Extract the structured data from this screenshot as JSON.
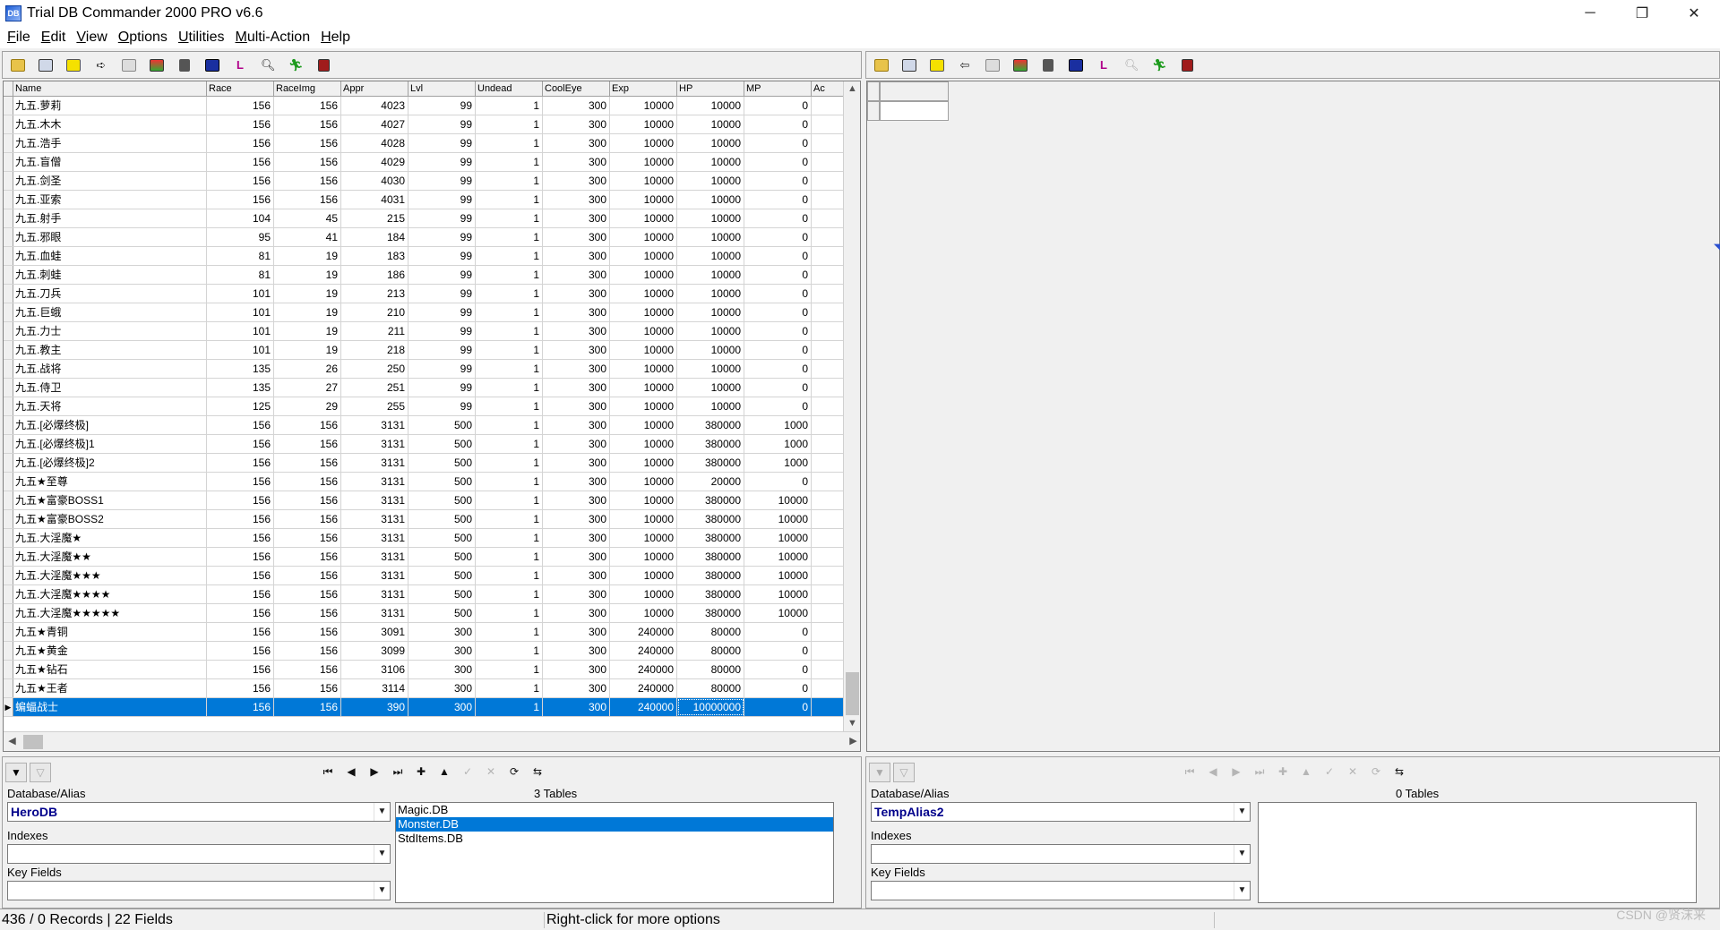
{
  "window": {
    "title": "Trial DB Commander 2000 PRO v6.6",
    "app_icon": "db-commander-app-icon",
    "controls": [
      "─",
      "❐",
      "✕"
    ]
  },
  "menu": [
    "File",
    "Edit",
    "View",
    "Options",
    "Utilities",
    "Multi-Action",
    "Help"
  ],
  "toolbar_icons_left": [
    "open-folder-icon",
    "table-icon",
    "key-icon",
    "arrow-icon",
    "page-icon",
    "filter-icon",
    "trash-icon",
    "db-icon",
    "l-icon",
    "search-icon",
    "run-icon",
    "exit-icon"
  ],
  "toolbar_icons_right": [
    "open-folder-icon",
    "table-icon",
    "key-icon",
    "arrow-icon",
    "page-icon",
    "filter-icon",
    "trash-icon",
    "db-icon",
    "l-icon",
    "search-icon",
    "run-icon",
    "exit-icon"
  ],
  "grid": {
    "columns": [
      "Name",
      "Race",
      "RaceImg",
      "Appr",
      "Lvl",
      "Undead",
      "CoolEye",
      "Exp",
      "HP",
      "MP",
      "Ac"
    ],
    "rows": [
      [
        "九五.萝莉",
        "156",
        "156",
        "4023",
        "99",
        "1",
        "300",
        "10000",
        "10000",
        "0",
        ""
      ],
      [
        "九五.木木",
        "156",
        "156",
        "4027",
        "99",
        "1",
        "300",
        "10000",
        "10000",
        "0",
        ""
      ],
      [
        "九五.浩手",
        "156",
        "156",
        "4028",
        "99",
        "1",
        "300",
        "10000",
        "10000",
        "0",
        ""
      ],
      [
        "九五.盲僧",
        "156",
        "156",
        "4029",
        "99",
        "1",
        "300",
        "10000",
        "10000",
        "0",
        ""
      ],
      [
        "九五.剑圣",
        "156",
        "156",
        "4030",
        "99",
        "1",
        "300",
        "10000",
        "10000",
        "0",
        ""
      ],
      [
        "九五.亚索",
        "156",
        "156",
        "4031",
        "99",
        "1",
        "300",
        "10000",
        "10000",
        "0",
        ""
      ],
      [
        "九五.射手",
        "104",
        "45",
        "215",
        "99",
        "1",
        "300",
        "10000",
        "10000",
        "0",
        ""
      ],
      [
        "九五.邪眼",
        "95",
        "41",
        "184",
        "99",
        "1",
        "300",
        "10000",
        "10000",
        "0",
        ""
      ],
      [
        "九五.血蛙",
        "81",
        "19",
        "183",
        "99",
        "1",
        "300",
        "10000",
        "10000",
        "0",
        ""
      ],
      [
        "九五.刺蛙",
        "81",
        "19",
        "186",
        "99",
        "1",
        "300",
        "10000",
        "10000",
        "0",
        ""
      ],
      [
        "九五.刀兵",
        "101",
        "19",
        "213",
        "99",
        "1",
        "300",
        "10000",
        "10000",
        "0",
        ""
      ],
      [
        "九五.巨蛾",
        "101",
        "19",
        "210",
        "99",
        "1",
        "300",
        "10000",
        "10000",
        "0",
        ""
      ],
      [
        "九五.力士",
        "101",
        "19",
        "211",
        "99",
        "1",
        "300",
        "10000",
        "10000",
        "0",
        ""
      ],
      [
        "九五.教主",
        "101",
        "19",
        "218",
        "99",
        "1",
        "300",
        "10000",
        "10000",
        "0",
        ""
      ],
      [
        "九五.战将",
        "135",
        "26",
        "250",
        "99",
        "1",
        "300",
        "10000",
        "10000",
        "0",
        ""
      ],
      [
        "九五.侍卫",
        "135",
        "27",
        "251",
        "99",
        "1",
        "300",
        "10000",
        "10000",
        "0",
        ""
      ],
      [
        "九五.天将",
        "125",
        "29",
        "255",
        "99",
        "1",
        "300",
        "10000",
        "10000",
        "0",
        ""
      ],
      [
        "九五.[必爆终极]",
        "156",
        "156",
        "3131",
        "500",
        "1",
        "300",
        "10000",
        "380000",
        "1000",
        ""
      ],
      [
        "九五.[必爆终极]1",
        "156",
        "156",
        "3131",
        "500",
        "1",
        "300",
        "10000",
        "380000",
        "1000",
        ""
      ],
      [
        "九五.[必爆终极]2",
        "156",
        "156",
        "3131",
        "500",
        "1",
        "300",
        "10000",
        "380000",
        "1000",
        ""
      ],
      [
        "九五★至尊",
        "156",
        "156",
        "3131",
        "500",
        "1",
        "300",
        "10000",
        "20000",
        "0",
        ""
      ],
      [
        "九五★富豪BOSS1",
        "156",
        "156",
        "3131",
        "500",
        "1",
        "300",
        "10000",
        "380000",
        "10000",
        ""
      ],
      [
        "九五★富豪BOSS2",
        "156",
        "156",
        "3131",
        "500",
        "1",
        "300",
        "10000",
        "380000",
        "10000",
        ""
      ],
      [
        "九五.大淫魔★",
        "156",
        "156",
        "3131",
        "500",
        "1",
        "300",
        "10000",
        "380000",
        "10000",
        ""
      ],
      [
        "九五.大淫魔★★",
        "156",
        "156",
        "3131",
        "500",
        "1",
        "300",
        "10000",
        "380000",
        "10000",
        ""
      ],
      [
        "九五.大淫魔★★★",
        "156",
        "156",
        "3131",
        "500",
        "1",
        "300",
        "10000",
        "380000",
        "10000",
        ""
      ],
      [
        "九五.大淫魔★★★★",
        "156",
        "156",
        "3131",
        "500",
        "1",
        "300",
        "10000",
        "380000",
        "10000",
        ""
      ],
      [
        "九五.大淫魔★★★★★",
        "156",
        "156",
        "3131",
        "500",
        "1",
        "300",
        "10000",
        "380000",
        "10000",
        ""
      ],
      [
        "九五★青铜",
        "156",
        "156",
        "3091",
        "300",
        "1",
        "300",
        "240000",
        "80000",
        "0",
        ""
      ],
      [
        "九五★黄金",
        "156",
        "156",
        "3099",
        "300",
        "1",
        "300",
        "240000",
        "80000",
        "0",
        ""
      ],
      [
        "九五★钻石",
        "156",
        "156",
        "3106",
        "300",
        "1",
        "300",
        "240000",
        "80000",
        "0",
        ""
      ],
      [
        "九五★王者",
        "156",
        "156",
        "3114",
        "300",
        "1",
        "300",
        "240000",
        "80000",
        "0",
        ""
      ],
      [
        "蝙蝠战士",
        "156",
        "156",
        "390",
        "300",
        "1",
        "300",
        "240000",
        "10000000",
        "0",
        ""
      ]
    ],
    "selected_row": 32,
    "current_marker": "▶"
  },
  "left_panel": {
    "nav_buttons": [
      "⏮",
      "◀",
      "▶",
      "⏭",
      "✚",
      "▲",
      "✓",
      "✕",
      "⟳",
      "⇆"
    ],
    "db_label": "Database/Alias",
    "db_value": "HeroDB",
    "indexes_label": "Indexes",
    "indexes_value": "",
    "keyfields_label": "Key Fields",
    "keyfields_value": "",
    "tables_label": "3 Tables",
    "tables": [
      "Magic.DB",
      "Monster.DB",
      "StdItems.DB"
    ],
    "selected_table": 1
  },
  "right_panel": {
    "nav_buttons": [
      "⏮",
      "◀",
      "▶",
      "⏭",
      "✚",
      "▲",
      "✓",
      "✕",
      "⟳",
      "⇆"
    ],
    "db_label": "Database/Alias",
    "db_value": "TempAlias2",
    "indexes_label": "Indexes",
    "indexes_value": "",
    "keyfields_label": "Key Fields",
    "keyfields_value": "",
    "tables_label": "0 Tables"
  },
  "status": {
    "records": "436 / 0 Records | 22 Fields",
    "hint": "Right-click for more options",
    "watermark": "CSDN @贤沫来"
  },
  "colors": {
    "selection": "#0078d7",
    "alias_text": "#00008b"
  }
}
